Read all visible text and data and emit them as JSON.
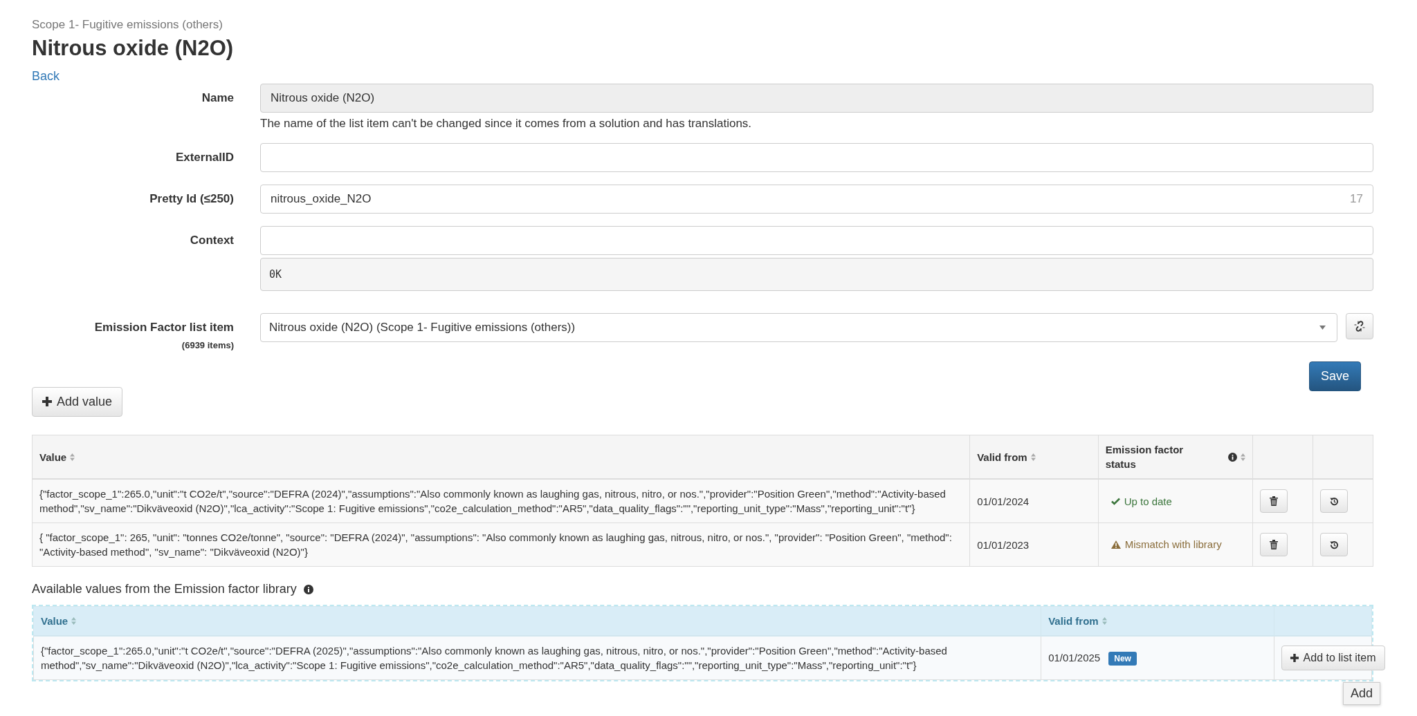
{
  "breadcrumb": "Scope 1- Fugitive emissions (others)",
  "title": "Nitrous oxide (N2O)",
  "back_link": "Back",
  "form": {
    "name": {
      "label": "Name",
      "value": "Nitrous oxide (N2O)",
      "disabled": true,
      "help": "The name of the list item can't be changed since it comes from a solution and has translations."
    },
    "external_id": {
      "label": "ExternalID"
    },
    "pretty_id": {
      "label": "Pretty Id (≤250)",
      "value": "nitrous_oxide_N2O",
      "counter": "17"
    },
    "context": {
      "label": "Context",
      "preview": "0K"
    },
    "emission_factor": {
      "label": "Emission Factor list item",
      "sublabel": "(6939 items)",
      "value": "Nitrous oxide (N2O) (Scope 1- Fugitive emissions (others))"
    }
  },
  "save_button": "Save",
  "add_value_button": "Add value",
  "values_table": {
    "columns": [
      "Value",
      "Valid from",
      "Emission factor status"
    ],
    "rows": [
      {
        "value": "{\"factor_scope_1\":265.0,\"unit\":\"t CO2e/t\",\"source\":\"DEFRA (2024)\",\"assumptions\":\"Also commonly known as laughing gas, nitrous, nitro, or nos.\",\"provider\":\"Position Green\",\"method\":\"Activity-based method\",\"sv_name\":\"Dikväveoxid (N2O)\",\"lca_activity\":\"Scope 1: Fugitive emissions\",\"co2e_calculation_method\":\"AR5\",\"data_quality_flags\":\"\",\"reporting_unit_type\":\"Mass\",\"reporting_unit\":\"t\"}",
        "valid_from": "01/01/2024",
        "status": {
          "kind": "ok",
          "text": "Up to date"
        }
      },
      {
        "value": "{ \"factor_scope_1\": 265, \"unit\": \"tonnes CO2e/tonne\", \"source\": \"DEFRA (2024)\", \"assumptions\": \"Also commonly known as laughing gas, nitrous, nitro, or nos.\", \"provider\": \"Position Green\", \"method\": \"Activity-based method\", \"sv_name\": \"Dikväveoxid (N2O)\"}",
        "valid_from": "01/01/2023",
        "status": {
          "kind": "mismatch",
          "text": "Mismatch with library"
        }
      }
    ]
  },
  "library": {
    "heading": "Available values from the Emission factor library",
    "columns": [
      "Value",
      "Valid from"
    ],
    "rows": [
      {
        "value": "{\"factor_scope_1\":265.0,\"unit\":\"t CO2e/t\",\"source\":\"DEFRA (2025)\",\"assumptions\":\"Also commonly known as laughing gas, nitrous, nitro, or nos.\",\"provider\":\"Position Green\",\"method\":\"Activity-based method\",\"sv_name\":\"Dikväveoxid (N2O)\",\"lca_activity\":\"Scope 1: Fugitive emissions\",\"co2e_calculation_method\":\"AR5\",\"data_quality_flags\":\"\",\"reporting_unit_type\":\"Mass\",\"reporting_unit\":\"t\"}",
        "valid_from": "01/01/2025",
        "badge": "New",
        "button": "Add to list item"
      }
    ]
  },
  "tooltip": "Add"
}
